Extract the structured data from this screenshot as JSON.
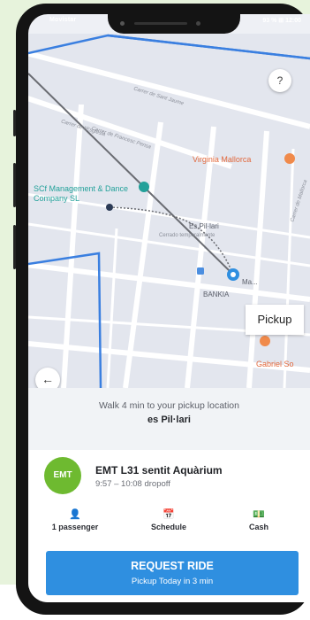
{
  "status": {
    "carrier": "Movistar",
    "battery": "93 % ⊞ 12:00"
  },
  "map": {
    "streets": [
      "Carrer de Sant Jaume",
      "Carrer de l'Església",
      "Carrer de Francesc Pensa",
      "Carrer de Mallorca"
    ],
    "poi_virginia": "Virginia Mallorca",
    "poi_scf": "SCf Management & Dance Company SL",
    "place_name": "Es Pil·lari",
    "place_sub": "Cerrado temporalmente",
    "place_bankia": "BANKIA",
    "place_partial": "Ma...",
    "poi_gabriel": "Gabriel So",
    "pickup_label": "Pickup",
    "help_symbol": "?",
    "back_symbol": "←"
  },
  "walk": {
    "line1": "Walk 4 min to your pickup location",
    "line2": "es Pil·lari"
  },
  "route": {
    "logo": "EMT",
    "title": "EMT L31 sentit Aquàrium",
    "time": "9:57 – 10:08 dropoff"
  },
  "options": [
    {
      "icon": "person-add-icon",
      "symbol": "👤",
      "label": "1 passenger"
    },
    {
      "icon": "calendar-icon",
      "symbol": "📅",
      "label": "Schedule"
    },
    {
      "icon": "cash-icon",
      "symbol": "💵",
      "label": "Cash"
    }
  ],
  "request": {
    "label": "REQUEST RIDE",
    "sublabel": "Pickup Today in 3 min"
  },
  "colors": {
    "accent_blue": "#2f8fe0",
    "map_outline_blue": "#3a7fe0",
    "emt_green": "#6eba30",
    "poi_orange": "#e2683c",
    "poi_teal": "#23a19a"
  }
}
